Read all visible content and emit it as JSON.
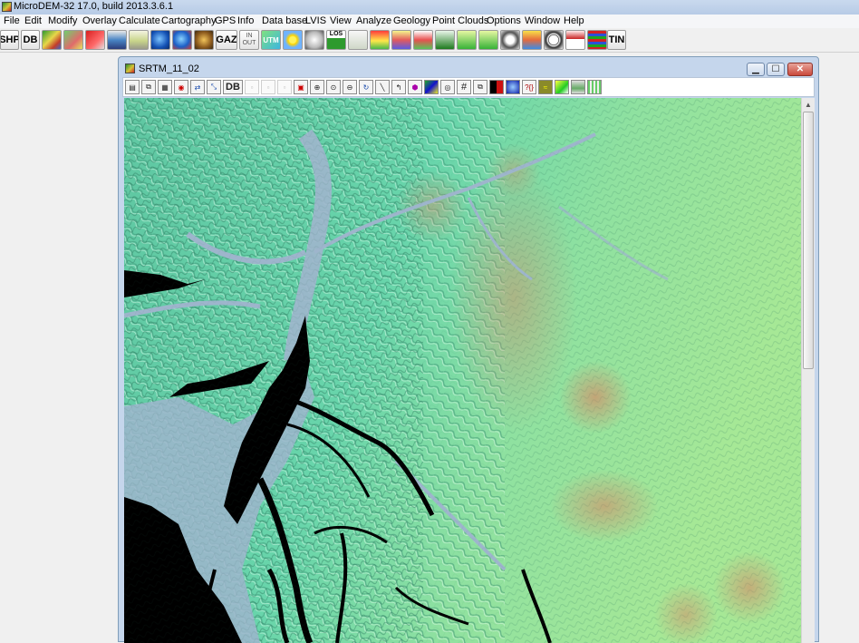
{
  "app": {
    "title": "MicroDEM-32 17.0, build 2013.3.6.1"
  },
  "menu": [
    "File",
    "Edit",
    "Modify",
    "Overlay",
    "Calculate",
    "Cartography",
    "GPS",
    "Info",
    "Data base",
    "LVIS",
    "View",
    "Analyze",
    "Geology",
    "Point Clouds",
    "Options",
    "Window",
    "Help"
  ],
  "toolbar": {
    "shp_label": "SHP",
    "db_label": "DB",
    "gaz_label": "GAZ",
    "in_out_label": "IN OUT",
    "utm_label": "UTM",
    "los_label": "LOS",
    "tin_label": "TIN"
  },
  "map_window": {
    "title": "SRTM_11_02",
    "db_label": "DB",
    "minimize_icon": "minimize-icon",
    "maximize_icon": "maximize-icon",
    "close_icon": "close-icon"
  },
  "colors": {
    "water": "#9eb5cc",
    "ocean": "#000000",
    "lowland": "#63d6b0",
    "highland": "#d79a6f",
    "window_frame": "#c5d6ec"
  }
}
